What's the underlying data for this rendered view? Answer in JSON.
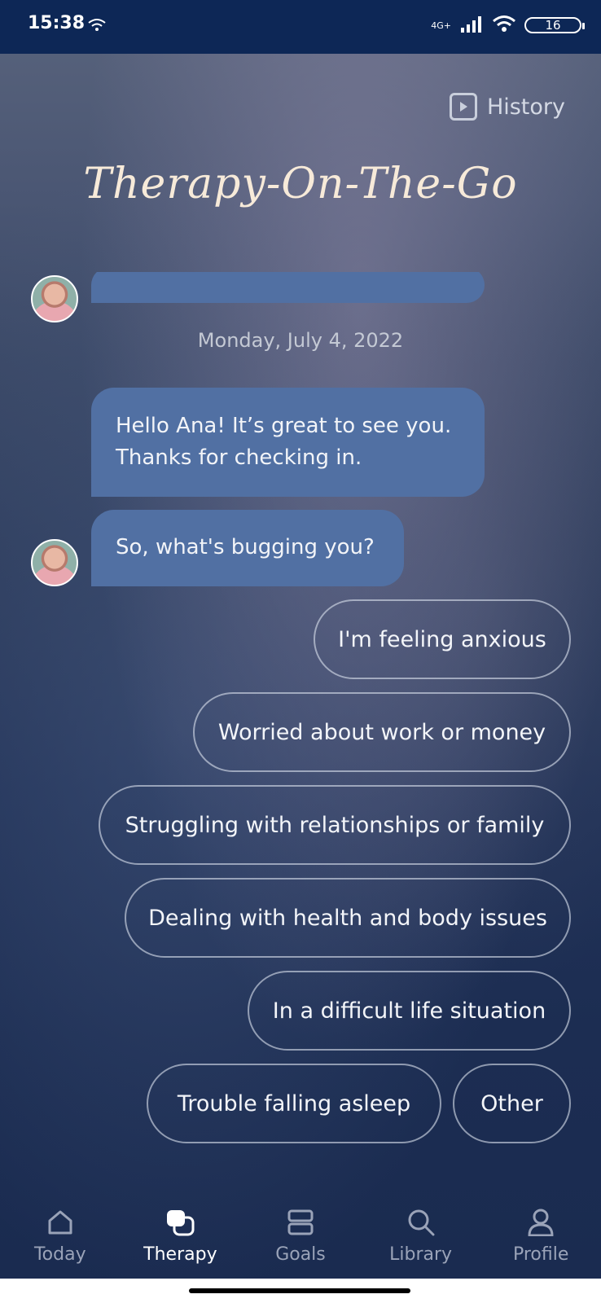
{
  "status": {
    "time": "15:38",
    "network": "4G+",
    "battery": "16"
  },
  "header": {
    "history_label": "History",
    "title": "Therapy-On-The-Go"
  },
  "chat": {
    "date": "Monday, July 4, 2022",
    "messages": [
      "Hello Ana! It’s great to see you. Thanks for checking in.",
      "So, what's bugging you?"
    ]
  },
  "options": [
    "I'm feeling anxious",
    "Worried about work or money",
    "Struggling with relationships or family",
    "Dealing with health and body issues",
    "In a difficult life situation",
    "Trouble falling asleep",
    "Other"
  ],
  "nav": [
    {
      "label": "Today",
      "icon": "home-icon"
    },
    {
      "label": "Therapy",
      "icon": "chat-icon",
      "active": true
    },
    {
      "label": "Goals",
      "icon": "goals-icon"
    },
    {
      "label": "Library",
      "icon": "search-icon"
    },
    {
      "label": "Profile",
      "icon": "person-icon"
    }
  ]
}
